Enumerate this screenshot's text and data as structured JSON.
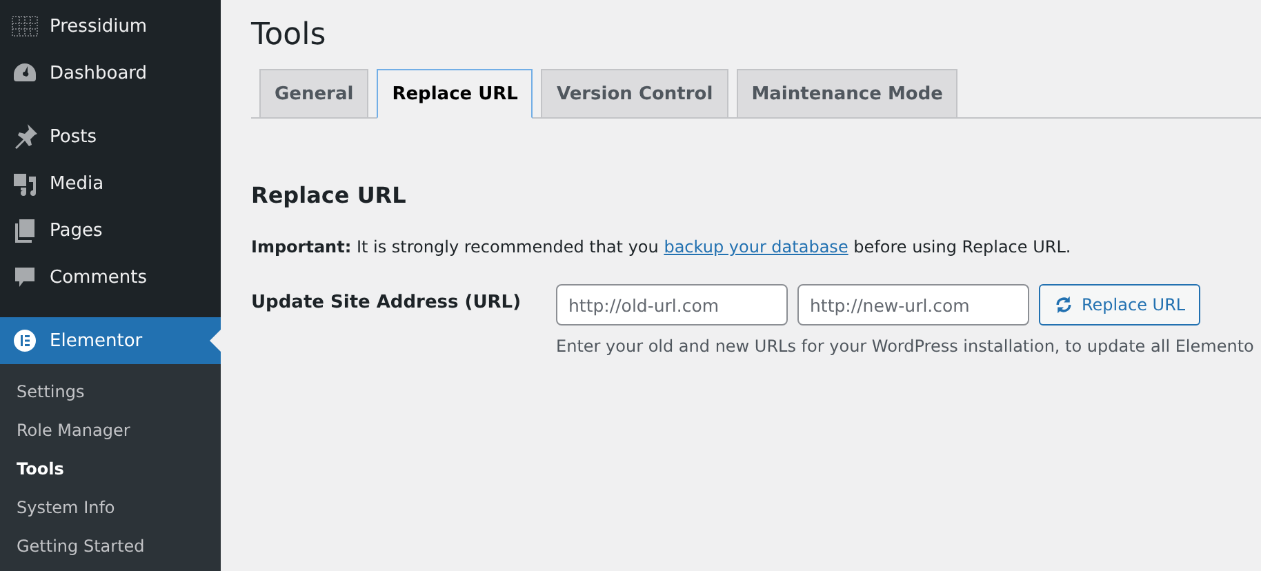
{
  "sidebar": {
    "groups": [
      {
        "items": [
          {
            "label": "Pressidium",
            "selected": false
          },
          {
            "label": "Dashboard",
            "selected": false
          }
        ]
      },
      {
        "items": [
          {
            "label": "Posts",
            "selected": false
          },
          {
            "label": "Media",
            "selected": false
          },
          {
            "label": "Pages",
            "selected": false
          },
          {
            "label": "Comments",
            "selected": false
          }
        ]
      },
      {
        "items": [
          {
            "label": "Elementor",
            "selected": true,
            "children": [
              {
                "label": "Settings",
                "selected": false
              },
              {
                "label": "Role Manager",
                "selected": false
              },
              {
                "label": "Tools",
                "selected": true
              },
              {
                "label": "System Info",
                "selected": false
              },
              {
                "label": "Getting Started",
                "selected": false
              }
            ]
          }
        ]
      }
    ]
  },
  "page": {
    "title": "Tools",
    "tabs": [
      {
        "label": "General",
        "selected": false
      },
      {
        "label": "Replace URL",
        "selected": true
      },
      {
        "label": "Version Control",
        "selected": false
      },
      {
        "label": "Maintenance Mode",
        "selected": false
      }
    ],
    "section": {
      "heading": "Replace URL",
      "notice": {
        "before": "**Important:** It is strongly recommended that you ",
        "link": "backup your database",
        "after": " before using Replace URL."
      },
      "form": {
        "label": "Update Site Address (URL)",
        "old_field": {
          "placeholder": "http://old-url.com"
        },
        "new_field": {
          "placeholder": "http://new-url.com"
        },
        "button": "Replace URL",
        "description": "Enter your old and new URLs for your WordPress installation, to update all Elemento"
      }
    }
  }
}
